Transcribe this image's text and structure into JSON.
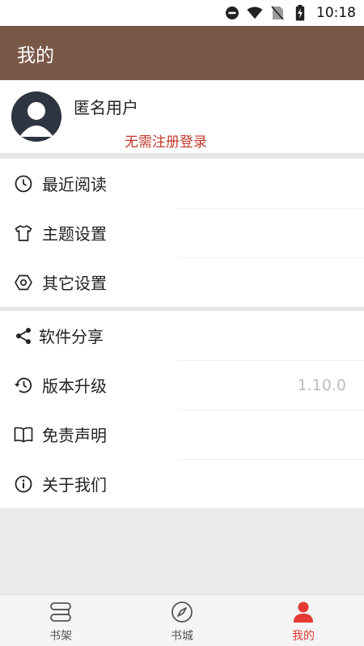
{
  "status_bar": {
    "time": "10:18",
    "icons": [
      "do-not-disturb-icon",
      "wifi-icon",
      "no-sim-icon",
      "battery-charging-icon"
    ]
  },
  "app_bar": {
    "title": "我的"
  },
  "profile": {
    "username": "匿名用户",
    "login_hint": "无需注册登录",
    "avatar_icon": "default-avatar-icon"
  },
  "menu": {
    "group1": [
      {
        "label": "最近阅读",
        "icon": "clock-icon"
      },
      {
        "label": "主题设置",
        "icon": "tshirt-icon"
      },
      {
        "label": "其它设置",
        "icon": "hexagon-settings-icon"
      }
    ],
    "group2": [
      {
        "label": "软件分享",
        "icon": "share-icon"
      },
      {
        "label": "版本升级",
        "icon": "history-icon",
        "value": "1.10.0"
      },
      {
        "label": "免责声明",
        "icon": "book-icon"
      },
      {
        "label": "关于我们",
        "icon": "info-icon"
      }
    ]
  },
  "bottom_nav": {
    "tabs": [
      {
        "label": "书架",
        "icon": "bookshelf-icon",
        "active": false
      },
      {
        "label": "书城",
        "icon": "compass-icon",
        "active": false
      },
      {
        "label": "我的",
        "icon": "person-icon",
        "active": true
      }
    ]
  },
  "colors": {
    "app_bar": "#7a5848",
    "accent_red": "#e53935",
    "login_hint": "#c0392b"
  }
}
